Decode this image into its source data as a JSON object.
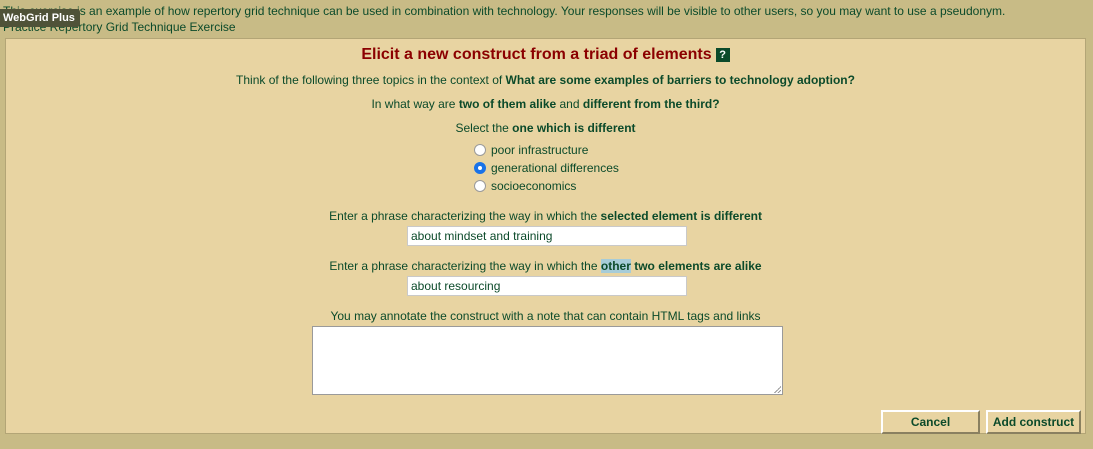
{
  "header": {
    "notice": "This exercise is an example of how repertory grid technique can be used in combination with technology. Your responses will be visible to other users, so you may want to use a pseudonym.",
    "subtitle": "Practice Repertory Grid Technique Exercise",
    "badge": "WebGrid Plus"
  },
  "panel": {
    "title": "Elicit a new construct from a triad of elements",
    "help_label": "?",
    "intro_prefix": "Think of the following three topics in the context of ",
    "intro_topic": "What are some examples of barriers to technology adoption?",
    "q_prefix": "In what way are ",
    "q_bold1": "two of them alike",
    "q_mid": " and ",
    "q_bold2": "different from the third?",
    "select_prefix": "Select the ",
    "select_bold": "one which is different",
    "elements": [
      {
        "label": "poor infrastructure",
        "selected": false
      },
      {
        "label": "generational differences",
        "selected": true
      },
      {
        "label": "socioeconomics",
        "selected": false
      }
    ],
    "diff_prefix": "Enter a phrase characterizing the way in which the ",
    "diff_bold": "selected element is different",
    "diff_value": "about mindset and training",
    "alike_prefix": "Enter a phrase characterizing the way in which the ",
    "alike_highlight": "other",
    "alike_bold": " two elements are alike",
    "alike_value": "about resourcing",
    "note_label": "You may annotate the construct with a note that can contain HTML tags and links",
    "note_value": "",
    "cancel_label": "Cancel",
    "add_label": "Add construct"
  }
}
